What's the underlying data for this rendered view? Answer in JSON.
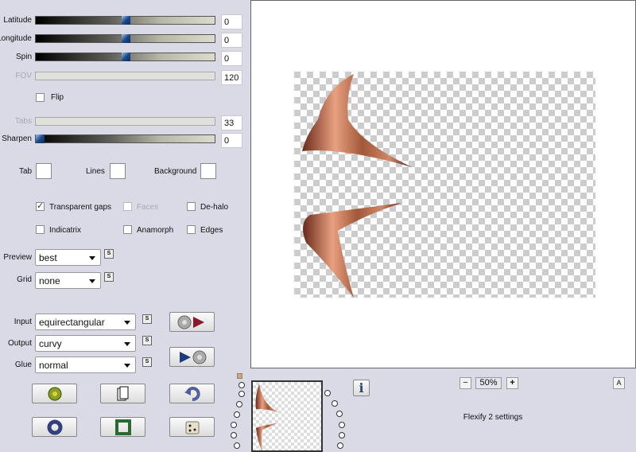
{
  "sliders": [
    {
      "label": "Latitude",
      "value": "0",
      "position": 0.5,
      "enabled": true
    },
    {
      "label": "Longitude",
      "value": "0",
      "position": 0.5,
      "enabled": true
    },
    {
      "label": "Spin",
      "value": "0",
      "position": 0.5,
      "enabled": true
    },
    {
      "label": "FOV",
      "value": "120",
      "enabled": false
    },
    {
      "label": "Tabs",
      "value": "33",
      "enabled": false
    },
    {
      "label": "Sharpen",
      "value": "0",
      "position": 0,
      "enabled": true
    }
  ],
  "flip": {
    "label": "Flip",
    "checked": false
  },
  "colors": {
    "tab": "Tab",
    "lines": "Lines",
    "background": "Background"
  },
  "options": {
    "transparent_gaps": "Transparent gaps",
    "faces": "Faces",
    "dehalo": "De-halo",
    "indicatrix": "Indicatrix",
    "anamorph": "Anamorph",
    "edges": "Edges"
  },
  "preview": {
    "label": "Preview",
    "value": "best"
  },
  "grid": {
    "label": "Grid",
    "value": "none"
  },
  "input": {
    "label": "Input",
    "value": "equirectangular"
  },
  "output": {
    "label": "Output",
    "value": "curvy"
  },
  "glue": {
    "label": "Glue",
    "value": "normal"
  },
  "link_icon": "S",
  "zoom": {
    "minus": "−",
    "value": "50%",
    "plus": "+"
  },
  "info_icon": "i",
  "collapse_icon": "A",
  "status": "Flexify 2 settings"
}
